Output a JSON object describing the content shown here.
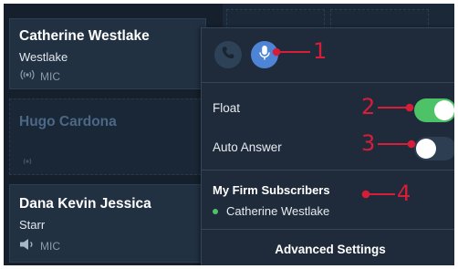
{
  "contacts": [
    {
      "name": "Catherine Westlake",
      "subtitle": "Westlake",
      "mic_label": "MIC"
    },
    {
      "name": "Hugo Cardona",
      "subtitle": "",
      "mic_label": ""
    },
    {
      "name": "Dana Kevin Jessica",
      "subtitle": "Starr",
      "mic_label": "MIC"
    }
  ],
  "popover": {
    "float_label": "Float",
    "float_on": true,
    "auto_answer_label": "Auto Answer",
    "auto_answer_on": false,
    "subscribers_title": "My Firm Subscribers",
    "subscribers": [
      "Catherine Westlake"
    ],
    "advanced_label": "Advanced Settings"
  },
  "callouts": [
    "1",
    "2",
    "3",
    "4"
  ],
  "colors": {
    "background": "#15202c",
    "popover": "#1f2b3a",
    "toggle_on": "#4ec267",
    "mic_active": "#4d84d6",
    "callout": "#d71d38"
  },
  "icons": [
    "phone-icon",
    "microphone-icon",
    "broadcast-icon",
    "speaker-icon"
  ]
}
